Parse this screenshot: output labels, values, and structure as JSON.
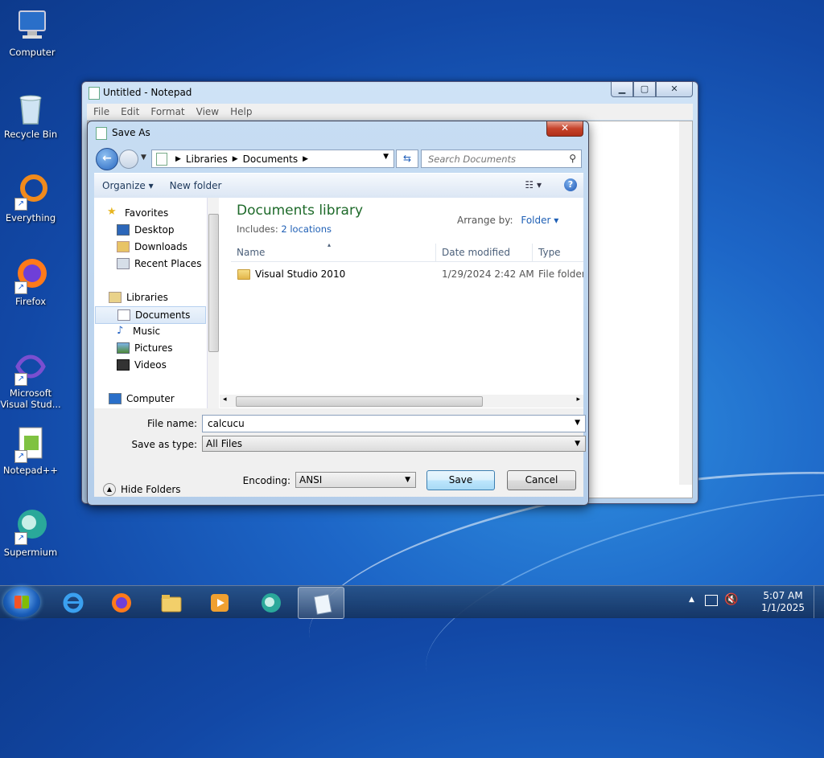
{
  "desktop": {
    "icons": [
      {
        "label": "Computer"
      },
      {
        "label": "Recycle Bin"
      },
      {
        "label": "Everything"
      },
      {
        "label": "Firefox"
      },
      {
        "label": "Microsoft Visual Stud..."
      },
      {
        "label": "Notepad++"
      },
      {
        "label": "Supermium"
      }
    ]
  },
  "notepad": {
    "title": "Untitled - Notepad",
    "menu": [
      "File",
      "Edit",
      "Format",
      "View",
      "Help"
    ]
  },
  "dialog": {
    "title": "Save As",
    "close_glyph": "✕",
    "address": [
      "Libraries",
      "Documents"
    ],
    "search_placeholder": "Search Documents",
    "toolbar": {
      "organize": "Organize",
      "new_folder": "New folder"
    },
    "nav": {
      "favorites": "Favorites",
      "desktop": "Desktop",
      "downloads": "Downloads",
      "recent_places": "Recent Places",
      "libraries": "Libraries",
      "documents": "Documents",
      "music": "Music",
      "pictures": "Pictures",
      "videos": "Videos",
      "computer": "Computer"
    },
    "library_title": "Documents library",
    "includes_label": "Includes:",
    "includes_link": "2 locations",
    "arrange_label": "Arrange by:",
    "arrange_value": "Folder",
    "columns": {
      "name": "Name",
      "date": "Date modified",
      "type": "Type"
    },
    "rows": [
      {
        "name": "Visual Studio 2010",
        "date": "1/29/2024 2:42 AM",
        "type": "File folder"
      }
    ],
    "file_name_label": "File name:",
    "file_name_value": "calcucu",
    "save_type_label": "Save as type:",
    "save_type_value": "All Files",
    "hide_folders": "Hide Folders",
    "encoding_label": "Encoding:",
    "encoding_value": "ANSI",
    "save_button": "Save",
    "cancel_button": "Cancel"
  },
  "taskbar": {
    "time": "5:07 AM",
    "date": "1/1/2025"
  },
  "colors": {
    "desktop_blue": "#1d66c7",
    "library_title_green": "#1e6a2a",
    "link_blue": "#1e5fb5"
  }
}
